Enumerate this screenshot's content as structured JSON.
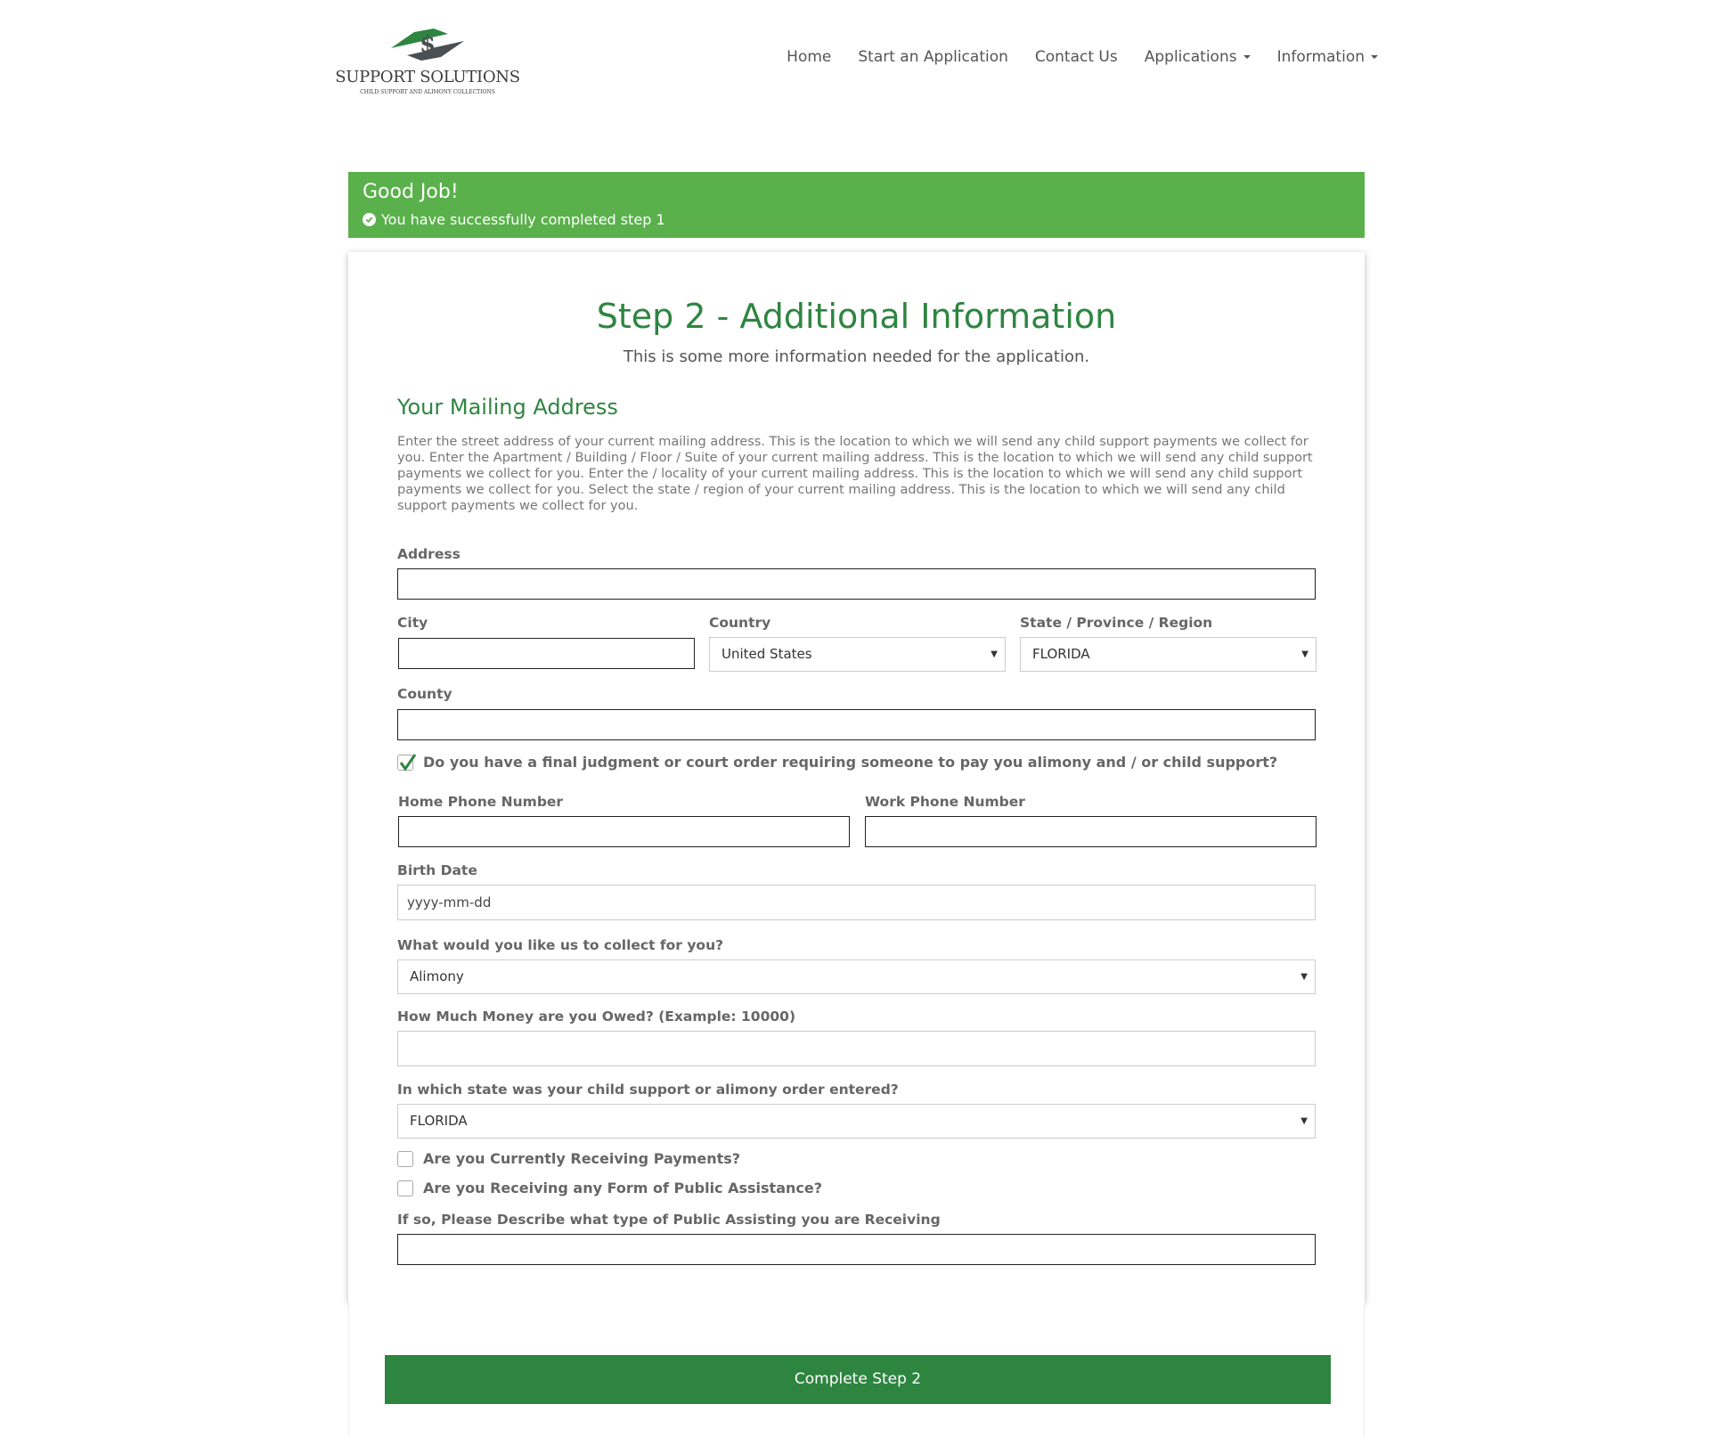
{
  "header": {
    "logo_title": "SUPPORT SOLUTIONS",
    "logo_subtitle": "CHILD SUPPORT AND ALIMONY COLLECTIONS",
    "nav": {
      "home": "Home",
      "start": "Start an Application",
      "contact": "Contact Us",
      "applications": "Applications",
      "information": "Information"
    }
  },
  "alert": {
    "title": "Good Job!",
    "message": "You have successfully completed step 1",
    "color": "#5ab14b"
  },
  "form": {
    "title": "Step 2 - Additional Information",
    "subtitle": "This is some more information needed for the application.",
    "section_title": "Your Mailing Address",
    "description": "Enter the street address of your current mailing address. This is the location to which we will send any child support payments we collect for you. Enter the Apartment / Building / Floor / Suite of your current mailing address. This is the location to which we will send any child support payments we collect for you. Enter the / locality of your current mailing address. This is the location to which we will send any child support payments we collect for you. Select the state / region of your current mailing address. This is the location to which we will send any child support payments we collect for you.",
    "address_label": "Address",
    "address_value": "",
    "city_label": "City",
    "city_value": "",
    "country_label": "Country",
    "country_value": "United States",
    "state_label": "State / Province / Region",
    "state_value": "FLORIDA",
    "county_label": "County",
    "county_value": "",
    "judgment_question": "Do you have a final judgment or court order requiring someone to pay you alimony and / or child support?",
    "judgment_checked": true,
    "home_phone_label": "Home Phone Number",
    "home_phone_value": "",
    "work_phone_label": "Work Phone Number",
    "work_phone_value": "",
    "birth_date_label": "Birth Date",
    "birth_date_placeholder": "yyyy-mm-dd",
    "collect_label": "What would you like us to collect for you?",
    "collect_value": "Alimony",
    "owed_label": "How Much Money are you Owed? (Example: 10000)",
    "owed_value": "",
    "order_state_label": "In which state was your child support or alimony order entered?",
    "order_state_value": "FLORIDA",
    "receiving_payments_label": "Are you Currently Receiving Payments?",
    "receiving_payments_checked": false,
    "public_assistance_label": "Are you Receiving any Form of Public Assistance?",
    "public_assistance_checked": false,
    "assistance_type_label": "If so, Please Describe what type of Public Assisting you are Receiving",
    "assistance_type_value": "",
    "submit_label": "Complete Step 2"
  },
  "colors": {
    "brand_green": "#2e8540",
    "success_green": "#5ab14b"
  }
}
